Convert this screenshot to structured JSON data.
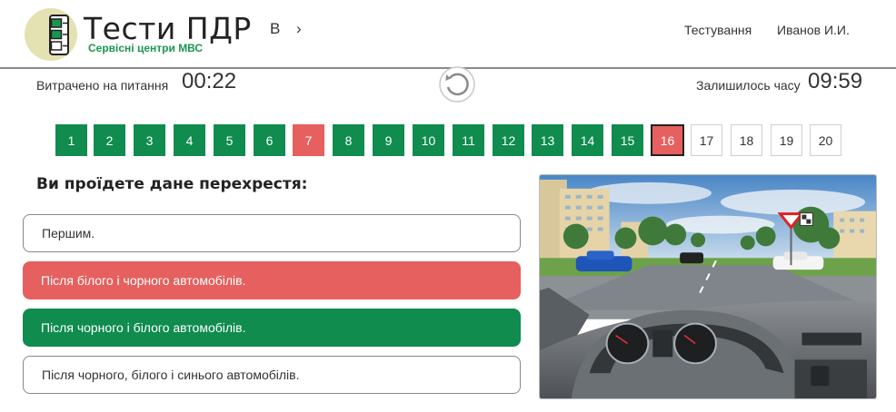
{
  "header": {
    "logo_title": "Тести ПДР",
    "logo_subtitle": "Сервісні центри МВС",
    "nav_letter": "B",
    "nav_arrow": "›",
    "menu_testing": "Тестування",
    "user_name": "Иванов И.И."
  },
  "timers": {
    "spent_label": "Витрачено на питання",
    "spent_value": "00:22",
    "remaining_label": "Залишилось часу",
    "remaining_value": "09:59",
    "reset_icon": "refresh-icon"
  },
  "questions": [
    {
      "number": "1",
      "status": "correct"
    },
    {
      "number": "2",
      "status": "correct"
    },
    {
      "number": "3",
      "status": "correct"
    },
    {
      "number": "4",
      "status": "correct"
    },
    {
      "number": "5",
      "status": "correct"
    },
    {
      "number": "6",
      "status": "correct"
    },
    {
      "number": "7",
      "status": "wrong"
    },
    {
      "number": "8",
      "status": "correct"
    },
    {
      "number": "9",
      "status": "correct"
    },
    {
      "number": "10",
      "status": "correct"
    },
    {
      "number": "11",
      "status": "correct"
    },
    {
      "number": "12",
      "status": "correct"
    },
    {
      "number": "13",
      "status": "correct"
    },
    {
      "number": "14",
      "status": "correct"
    },
    {
      "number": "15",
      "status": "correct"
    },
    {
      "number": "16",
      "status": "wrong-current"
    },
    {
      "number": "17",
      "status": "unanswered"
    },
    {
      "number": "18",
      "status": "unanswered"
    },
    {
      "number": "19",
      "status": "unanswered"
    },
    {
      "number": "20",
      "status": "unanswered"
    }
  ],
  "question": {
    "text": "Ви проїдете дане перехрестя:",
    "answers": [
      {
        "text": "Першим.",
        "state": "plain"
      },
      {
        "text": "Після білого і чорного автомобілів.",
        "state": "wrong"
      },
      {
        "text": "Після чорного і білого автомобілів.",
        "state": "correct"
      },
      {
        "text": "Після чорного, білого і синього автомобілів.",
        "state": "plain"
      }
    ]
  },
  "colors": {
    "correct": "#0f8c4e",
    "wrong": "#e5605e",
    "brand_green": "#1a9650"
  }
}
